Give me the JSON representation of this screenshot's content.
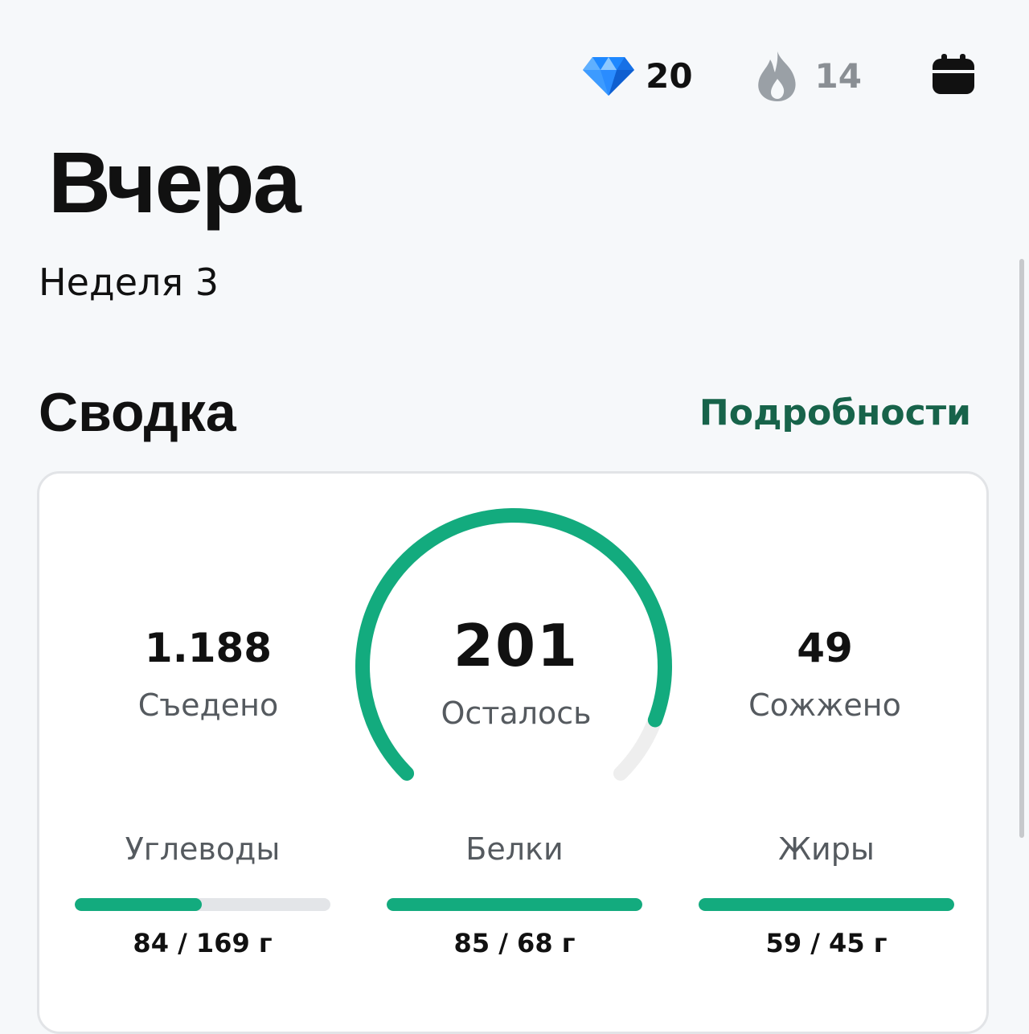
{
  "header": {
    "gems": {
      "icon": "diamond-icon",
      "value": "20"
    },
    "streak": {
      "icon": "flame-icon",
      "value": "14"
    },
    "calendar": {
      "icon": "calendar-icon"
    }
  },
  "page": {
    "title": "Вчера",
    "subtitle": "Неделя 3"
  },
  "summary": {
    "title": "Сводка",
    "details_label": "Подробности",
    "eaten": {
      "value": "1.188",
      "label": "Съедено"
    },
    "remaining": {
      "value": "201",
      "label": "Осталось",
      "progress": 0.91
    },
    "burned": {
      "value": "49",
      "label": "Сожжено"
    },
    "macros": [
      {
        "name": "Углеводы",
        "amount": "84 / 169 г",
        "progress": 0.497
      },
      {
        "name": "Белки",
        "amount": "85 / 68 г",
        "progress": 1
      },
      {
        "name": "Жиры",
        "amount": "59 / 45 г",
        "progress": 1
      }
    ]
  },
  "colors": {
    "accent": "#13ab7e",
    "link": "#17634a",
    "track": "#e3e5e8",
    "background": "#f6f8fa"
  }
}
